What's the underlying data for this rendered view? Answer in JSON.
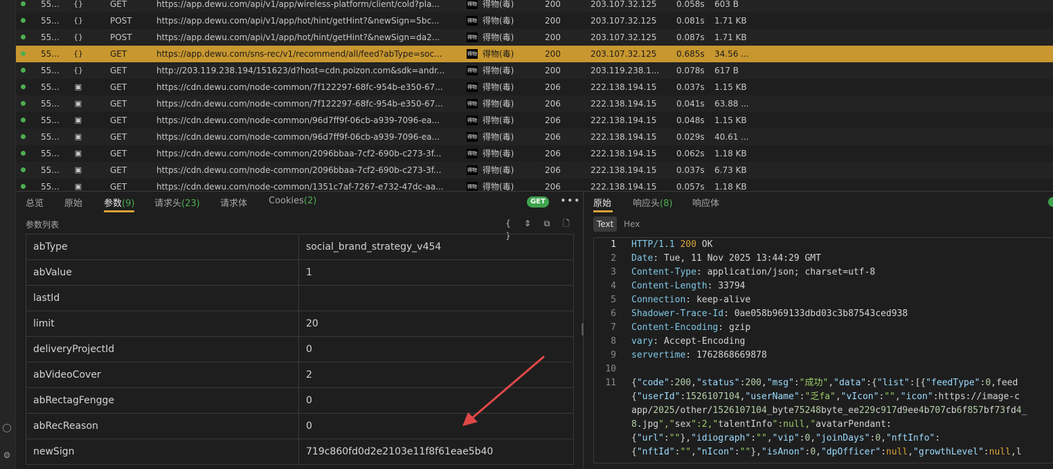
{
  "requests": [
    {
      "id": "55...",
      "type_icon": "{}",
      "method": "GET",
      "url": "https://app.dewu.com/api/v1/app/wireless-platform/client/cold?pla...",
      "app": "得物(毒)",
      "status": "200",
      "ip": "203.107.32.125",
      "time": "0.058s",
      "size": "603 B",
      "selected": false
    },
    {
      "id": "55...",
      "type_icon": "{}",
      "method": "POST",
      "url": "https://app.dewu.com/api/v1/app/hot/hint/getHint?&newSign=5bc...",
      "app": "得物(毒)",
      "status": "200",
      "ip": "203.107.32.125",
      "time": "0.081s",
      "size": "1.71 KB",
      "selected": false
    },
    {
      "id": "55...",
      "type_icon": "{}",
      "method": "POST",
      "url": "https://app.dewu.com/api/v1/app/hot/hint/getHint?&newSign=da2...",
      "app": "得物(毒)",
      "status": "200",
      "ip": "203.107.32.125",
      "time": "0.087s",
      "size": "1.71 KB",
      "selected": false
    },
    {
      "id": "55...",
      "type_icon": "{}",
      "method": "GET",
      "url": "https://app.dewu.com/sns-rec/v1/recommend/all/feed?abType=soc...",
      "app": "得物(毒)",
      "status": "200",
      "ip": "203.107.32.125",
      "time": "0.685s",
      "size": "34.56 ...",
      "selected": true
    },
    {
      "id": "55...",
      "type_icon": "{}",
      "method": "GET",
      "url": "http://203.119.238.194/151623/d?host=cdn.poizon.com&sdk=andr...",
      "app": "得物(毒)",
      "status": "200",
      "ip": "203.119.238.1...",
      "time": "0.078s",
      "size": "617 B",
      "selected": false
    },
    {
      "id": "55...",
      "type_icon": "img",
      "method": "GET",
      "url": "https://cdn.dewu.com/node-common/7f122297-68fc-954b-e350-67...",
      "app": "得物(毒)",
      "status": "206",
      "ip": "222.138.194.15",
      "time": "0.037s",
      "size": "1.15 KB",
      "selected": false
    },
    {
      "id": "55...",
      "type_icon": "img",
      "method": "GET",
      "url": "https://cdn.dewu.com/node-common/7f122297-68fc-954b-e350-67...",
      "app": "得物(毒)",
      "status": "206",
      "ip": "222.138.194.15",
      "time": "0.041s",
      "size": "63.88 ...",
      "selected": false
    },
    {
      "id": "55...",
      "type_icon": "img",
      "method": "GET",
      "url": "https://cdn.dewu.com/node-common/96d7ff9f-06cb-a939-7096-ea...",
      "app": "得物(毒)",
      "status": "206",
      "ip": "222.138.194.15",
      "time": "0.048s",
      "size": "1.15 KB",
      "selected": false
    },
    {
      "id": "55...",
      "type_icon": "img",
      "method": "GET",
      "url": "https://cdn.dewu.com/node-common/96d7ff9f-06cb-a939-7096-ea...",
      "app": "得物(毒)",
      "status": "206",
      "ip": "222.138.194.15",
      "time": "0.029s",
      "size": "40.61 ...",
      "selected": false
    },
    {
      "id": "55...",
      "type_icon": "img",
      "method": "GET",
      "url": "https://cdn.dewu.com/node-common/2096bbaa-7cf2-690b-c273-3f...",
      "app": "得物(毒)",
      "status": "206",
      "ip": "222.138.194.15",
      "time": "0.062s",
      "size": "1.18 KB",
      "selected": false
    },
    {
      "id": "55...",
      "type_icon": "img",
      "method": "GET",
      "url": "https://cdn.dewu.com/node-common/2096bbaa-7cf2-690b-c273-3f...",
      "app": "得物(毒)",
      "status": "206",
      "ip": "222.138.194.15",
      "time": "0.037s",
      "size": "6.73 KB",
      "selected": false
    },
    {
      "id": "55...",
      "type_icon": "img",
      "method": "GET",
      "url": "https://cdn.dewu.com/node-common/1351c7af-7267-e732-47dc-aa...",
      "app": "得物(毒)",
      "status": "206",
      "ip": "222.138.194.15",
      "time": "0.057s",
      "size": "1.18 KB",
      "selected": false
    }
  ],
  "app_icon_text": "得物",
  "request_tabs": {
    "overview": "总览",
    "raw": "原始",
    "params": "参数",
    "params_count": "(9)",
    "headers": "请求头",
    "headers_count": "(23)",
    "body": "请求体",
    "cookies": "Cookies",
    "cookies_count": "(2)"
  },
  "method_badge": "GET",
  "more_label": "•••",
  "params_title": "参数列表",
  "toolbar_icons": [
    "braces-icon",
    "expand-icon",
    "copy-icon",
    "file-icon"
  ],
  "params": [
    {
      "key": "abType",
      "value": "social_brand_strategy_v454"
    },
    {
      "key": "abValue",
      "value": "1"
    },
    {
      "key": "lastId",
      "value": ""
    },
    {
      "key": "limit",
      "value": "20"
    },
    {
      "key": "deliveryProjectId",
      "value": "0"
    },
    {
      "key": "abVideoCover",
      "value": "2"
    },
    {
      "key": "abRectagFengge",
      "value": "0"
    },
    {
      "key": "abRecReason",
      "value": "0"
    },
    {
      "key": "newSign",
      "value": "719c860fd0d2e2103e11f8f61eae5b40"
    }
  ],
  "response_tabs": {
    "raw": "原始",
    "headers": "响应头",
    "headers_count": "(8)",
    "body": "响应体"
  },
  "view_modes": {
    "text": "Text",
    "hex": "Hex"
  },
  "line_numbers": [
    "1",
    "2",
    "3",
    "4",
    "5",
    "6",
    "7",
    "8",
    "9",
    "10",
    "11"
  ],
  "response": {
    "status_proto": "HTTP/1.1",
    "status_code": "200",
    "status_text": "OK",
    "headers": [
      {
        "k": "Date",
        "v": "Tue, 11 Nov 2025 13:44:29 GMT"
      },
      {
        "k": "Content-Type",
        "v": "application/json; charset=utf-8"
      },
      {
        "k": "Content-Length",
        "v": "33794"
      },
      {
        "k": "Connection",
        "v": "keep-alive"
      },
      {
        "k": "Shadower-Trace-Id",
        "v": "0ae058b969133dbd03c3b87543ced938"
      },
      {
        "k": "Content-Encoding",
        "v": "gzip"
      },
      {
        "k": "vary",
        "v": "Accept-Encoding"
      },
      {
        "k": "servertime",
        "v": "1762868669878"
      }
    ],
    "body_lines": [
      "{\"code\":200,\"status\":200,\"msg\":\"成功\",\"data\":{\"list\":[{\"feedType\":0,\"feed",
      "{\"userId\":1526107104,\"userName\":\"乏fa\",\"vIcon\":\"\",\"icon\":\"https://image-c",
      "app/2025/other/1526107104_byte75248byte_ee229c917d9ee4b707cb6f857bf73fd4_",
      "8.jpg\",\"sex\":2,\"talentInfo\":null,\"avatarPendant\":",
      "{\"url\":\"\"},\"idiograph\":\"\",\"vip\":0,\"joinDays\":0,\"nftInfo\":",
      "{\"nftId\":\"\",\"nIcon\":\"\"},\"isAnon\":0,\"dpOfficer\":null,\"growthLevel\":null,\"l"
    ]
  },
  "colors": {
    "accent": "#d9a33a",
    "selected_row": "#c8972f",
    "success": "#3fa34d",
    "arrow": "#e04848"
  }
}
